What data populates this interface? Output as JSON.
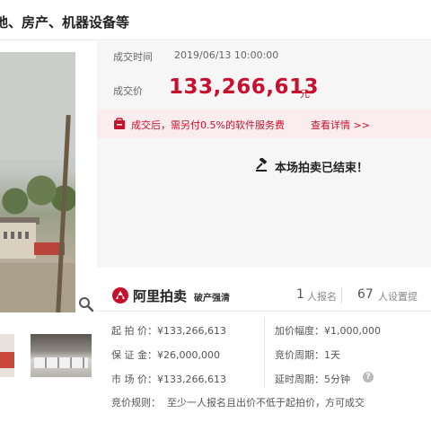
{
  "page_title": "地、房产、机器设备等",
  "info": {
    "deal_time_label": "成交时间",
    "deal_time_value": "2019/06/13 10:00:00",
    "deal_price_label": "成交价",
    "deal_price_value": "133,266,613",
    "deal_price_unit": "元",
    "fee_notice": "成交后，需另付0.5%的软件服务费",
    "fee_link": "查看详情 >>",
    "ended_message": "本场拍卖已结束！"
  },
  "brand": {
    "name": "阿里拍卖",
    "tag": "破产强清",
    "signups_count": "1",
    "signups_label": "人报名",
    "reminders_count": "67",
    "reminders_label": "人设置提"
  },
  "details": {
    "start_price": "起 拍 价：¥133,266,613",
    "increment": "加价幅度：¥1,000,000",
    "deposit": "保 证 金：¥26,000,000",
    "cycle": "竞价周期：1天",
    "market_price": "市 场 价：¥133,266,613",
    "delay": "延时周期：5分钟",
    "rule_label": "竞价规则：",
    "rule_text": "至少一人报名且出价不低于起拍价，方可成交"
  },
  "colors": {
    "accent": "#c8102e",
    "fee_bg": "#fbeced",
    "panel_bg": "#f6f6f6"
  },
  "icons": [
    "zoom-icon",
    "fee-notice-icon",
    "gavel-icon",
    "brand-logo-icon",
    "help-icon"
  ]
}
